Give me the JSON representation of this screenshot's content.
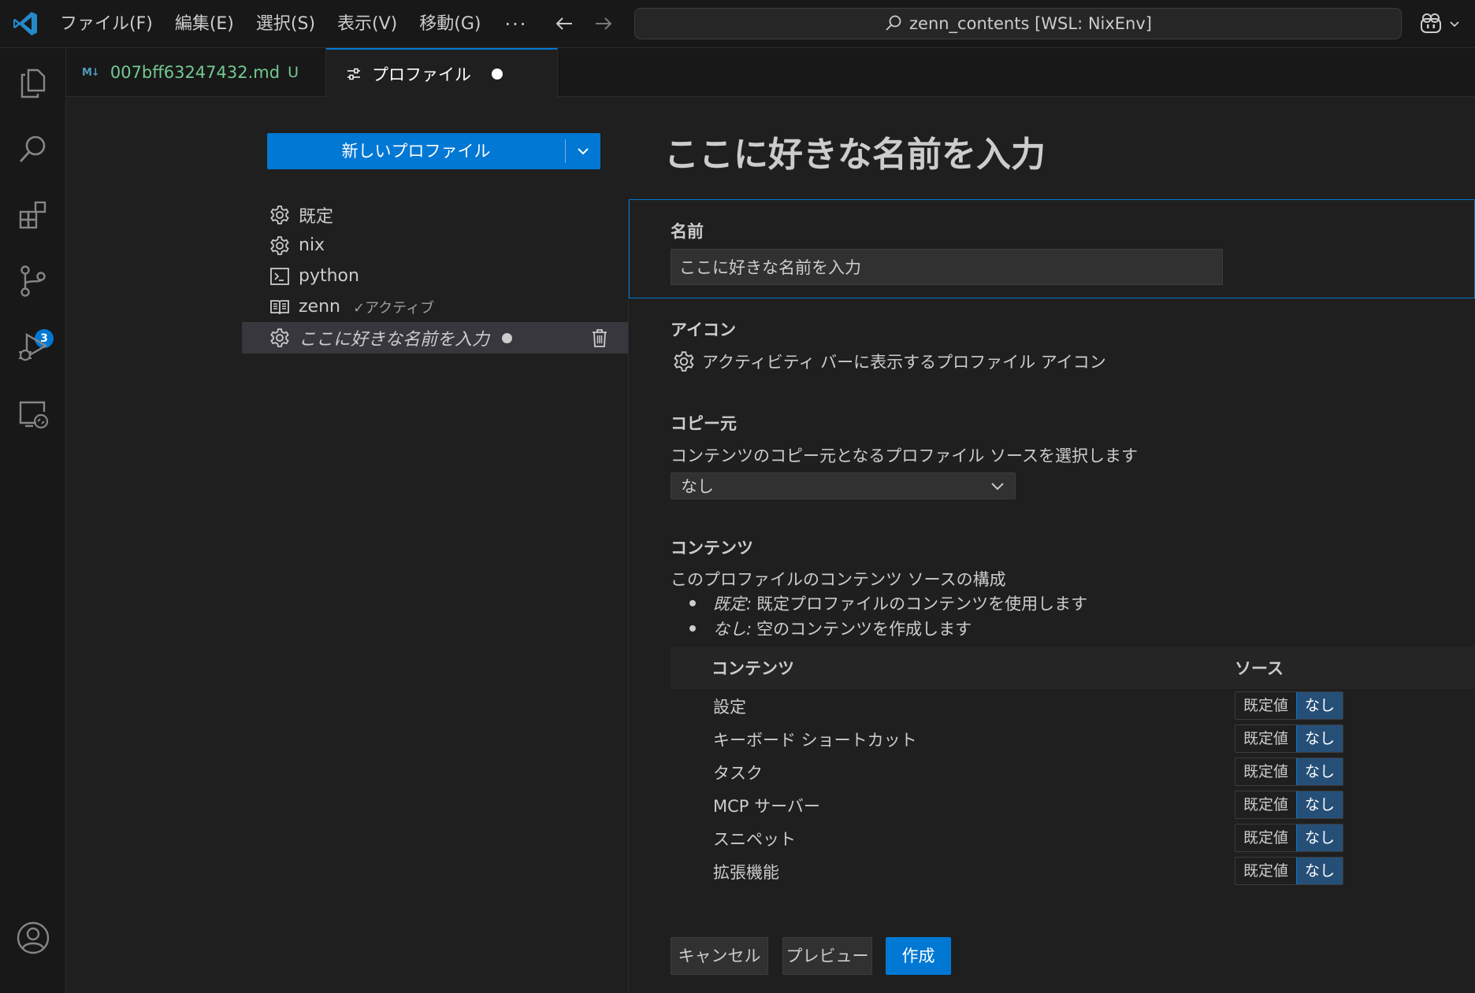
{
  "titlebar": {
    "menu": [
      "ファイル(F)",
      "編集(E)",
      "選択(S)",
      "表示(V)",
      "移動(G)"
    ],
    "more": "···",
    "command_center": "zenn_contents [WSL: NixEnv]"
  },
  "activitybar": {
    "source_control_badge": "3"
  },
  "tabs": {
    "file_tab": {
      "icon_text": "M↓",
      "label": "007bff63247432.md",
      "status": "U"
    },
    "profile_tab": {
      "label": "プロファイル"
    }
  },
  "profiles": {
    "new_button": "新しいプロファイル",
    "items": [
      {
        "label": "既定",
        "icon": "gear-icon"
      },
      {
        "label": "nix",
        "icon": "gear-icon"
      },
      {
        "label": "python",
        "icon": "terminal-icon"
      },
      {
        "label": "zenn",
        "icon": "book-icon",
        "active": "✓アクティブ"
      },
      {
        "label": "ここに好きな名前を入力",
        "icon": "gear-icon"
      }
    ]
  },
  "form": {
    "title": "ここに好きな名前を入力",
    "name_label": "名前",
    "name_value": "ここに好きな名前を入力",
    "icon_label": "アイコン",
    "icon_desc": "アクティビティ バーに表示するプロファイル アイコン",
    "copy_label": "コピー元",
    "copy_desc": "コンテンツのコピー元となるプロファイル ソースを選択します",
    "copy_value": "なし",
    "contents_label": "コンテンツ",
    "contents_desc": "このプロファイルのコンテンツ ソースの構成",
    "bullets": [
      {
        "term": "既定:",
        "text": "既定プロファイルのコンテンツを使用します"
      },
      {
        "term": "なし:",
        "text": "空のコンテンツを作成します"
      }
    ]
  },
  "contents_table": {
    "col_contents": "コンテンツ",
    "col_source": "ソース",
    "option_default": "既定値",
    "option_none": "なし",
    "rows": [
      "設定",
      "キーボード ショートカット",
      "タスク",
      "MCP サーバー",
      "スニペット",
      "拡張機能"
    ]
  },
  "buttons": {
    "cancel": "キャンセル",
    "preview": "プレビュー",
    "create": "作成"
  },
  "colors": {
    "accent": "#0078d4",
    "background": "#1f1f1f",
    "sidebar": "#181818",
    "untracked_green": "#73c991"
  }
}
